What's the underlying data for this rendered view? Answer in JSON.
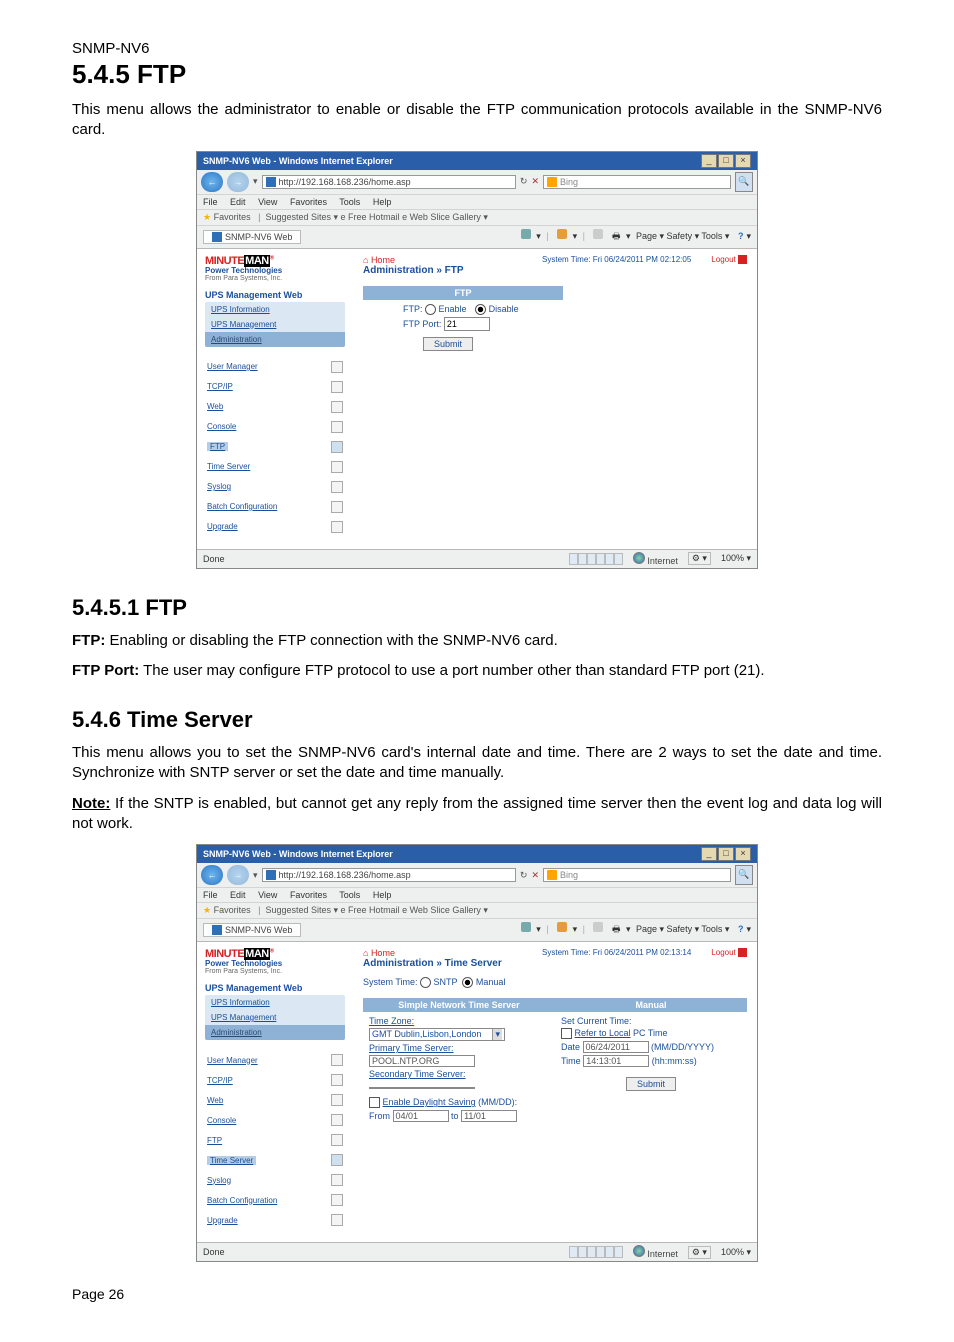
{
  "doc": {
    "product": "SNMP-NV6",
    "h1": "5.4.5 FTP",
    "intro1": "This menu allows the administrator to enable or disable the FTP communication protocols available in the SNMP-NV6 card.",
    "h2a": "5.4.5.1 FTP",
    "ftp_line1_b": "FTP:",
    "ftp_line1": " Enabling or disabling the FTP connection with the SNMP-NV6 card.",
    "ftp_line2_b": "FTP Port:",
    "ftp_line2": " The user may configure FTP protocol to use a port number other than standard FTP port (21).",
    "h2b": "5.4.6 Time Server",
    "ts_intro": "This menu allows you to set the SNMP-NV6 card's internal date and time. There are 2 ways to set the date and time. Synchronize with SNTP server or set the date and time manually.",
    "note_b": "Note:",
    "note": " If the SNTP is enabled, but cannot get any reply from the assigned time server then the event log and data log will not work.",
    "page": "Page 26"
  },
  "ie": {
    "title": "SNMP-NV6 Web - Windows Internet Explorer",
    "url": "http://192.168.168.236/home.asp",
    "search_hint": "Bing",
    "menus": [
      "File",
      "Edit",
      "View",
      "Favorites",
      "Tools",
      "Help"
    ],
    "fav_label": "Favorites",
    "fav_links": "Suggested Sites ▾   e  Free Hotmail  e  Web Slice Gallery ▾",
    "tab": "SNMP-NV6 Web",
    "tools": "Page ▾   Safety ▾   Tools ▾",
    "status_zone": "Internet",
    "status_done": "Done",
    "zoom": "100%"
  },
  "side": {
    "logo1": "MINUTE",
    "logo2": "MAN",
    "slogan1": "Power Technologies",
    "slogan2": "From Para Systems, Inc.",
    "section": "UPS Management Web",
    "groups": [
      "UPS Information",
      "UPS Management",
      "Administration"
    ],
    "items": [
      "User Manager",
      "TCP/IP",
      "Web",
      "Console",
      "FTP",
      "Time Server",
      "Syslog",
      "Batch Configuration",
      "Upgrade"
    ]
  },
  "ftp_page": {
    "home": "Home",
    "crumb": "Administration » FTP",
    "systime": "System Time: Fri 06/24/2011 PM 02:12:05",
    "logout": "Logout",
    "panel": "FTP",
    "lbl_ftp": "FTP:",
    "opt_enable": "Enable",
    "opt_disable": "Disable",
    "lbl_port": "FTP Port:",
    "port_val": "21",
    "submit": "Submit"
  },
  "ts_page": {
    "home": "Home",
    "crumb": "Administration » Time Server",
    "systime": "System Time: Fri 06/24/2011 PM 02:13:14",
    "logout": "Logout",
    "mode_label": "System Time:",
    "mode_sntp": "SNTP",
    "mode_manual": "Manual",
    "panel_sntp": "Simple Network Time Server",
    "panel_manual": "Manual",
    "tz_label": "Time Zone:",
    "tz_value": "GMT Dublin,Lisbon,London",
    "prim_label": "Primary Time Server:",
    "prim_value": "POOL.NTP.ORG",
    "sec_label": "Secondary Time Server:",
    "sec_value": "",
    "dst_label": "Enable Daylight Saving",
    "dst_fmt": " (MM/DD):",
    "dst_from": "From",
    "dst_from_v": "04/01",
    "dst_to": "to",
    "dst_to_v": "11/01",
    "man_head": "Set Current Time:",
    "man_refer": "Refer to Local",
    "man_refer_tail": " PC Time",
    "man_date_l": "Date",
    "man_date_v": "06/24/2011",
    "man_date_fmt": "(MM/DD/YYYY)",
    "man_time_l": "Time",
    "man_time_v": "14:13:01",
    "man_time_fmt": "(hh:mm:ss)",
    "submit": "Submit"
  }
}
